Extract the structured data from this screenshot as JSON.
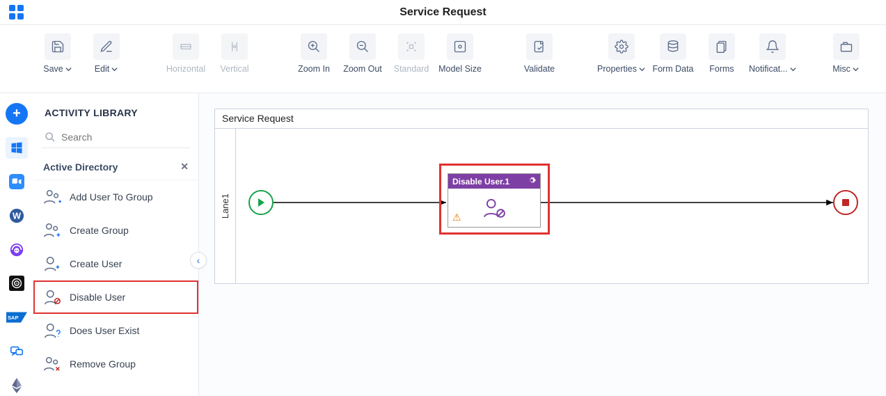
{
  "app": {
    "title": "Service Request"
  },
  "toolbar": {
    "save": "Save",
    "edit": "Edit",
    "horizontal": "Horizontal",
    "vertical": "Vertical",
    "zoomin": "Zoom In",
    "zoomout": "Zoom Out",
    "standard": "Standard",
    "modelsize": "Model Size",
    "validate": "Validate",
    "properties": "Properties",
    "formdata": "Form Data",
    "forms": "Forms",
    "notifications": "Notificat...",
    "misc": "Misc"
  },
  "sidebar": {
    "title": "ACTIVITY LIBRARY",
    "search_placeholder": "Search",
    "category": "Active Directory",
    "items": [
      "Add User To Group",
      "Create Group",
      "Create User",
      "Disable User",
      "Does User Exist",
      "Remove Group"
    ]
  },
  "canvas": {
    "process_name": "Service Request",
    "lane": "Lane1",
    "task": {
      "title": "Disable User.1"
    }
  },
  "iconrail": [
    "add",
    "windows",
    "zoom",
    "wordpress",
    "support",
    "target",
    "sap",
    "chat",
    "ethereum"
  ]
}
